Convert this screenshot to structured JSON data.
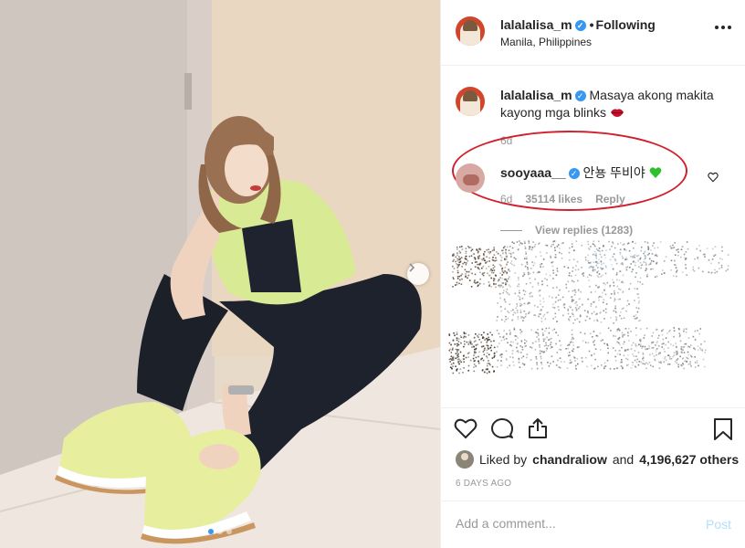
{
  "header": {
    "username": "lalalalisa_m",
    "follow_label": "Following",
    "location": "Manila, Philippines"
  },
  "caption": {
    "username": "lalalalisa_m",
    "text": "Masaya akong makita kayong mga blinks",
    "emoji": "lips-icon",
    "time": "6d"
  },
  "comment": {
    "username": "sooyaaa__",
    "text": "안뇽 뚜비야",
    "emoji": "green-heart-icon",
    "time": "6d",
    "likes": "35114 likes",
    "reply_label": "Reply"
  },
  "view_replies": "View replies (1283)",
  "likes": {
    "prefix": "Liked by",
    "user": "chandraliow",
    "conj": "and",
    "count": "4,196,627 others"
  },
  "timestamp": "6 DAYS AGO",
  "add_comment": {
    "placeholder": "Add a comment...",
    "post_label": "Post"
  },
  "carousel": {
    "slides": 3,
    "active": 1
  },
  "colors": {
    "accent": "#3897f0",
    "highlight_circle": "#d0202c",
    "post_disabled": "#b2dffc"
  }
}
